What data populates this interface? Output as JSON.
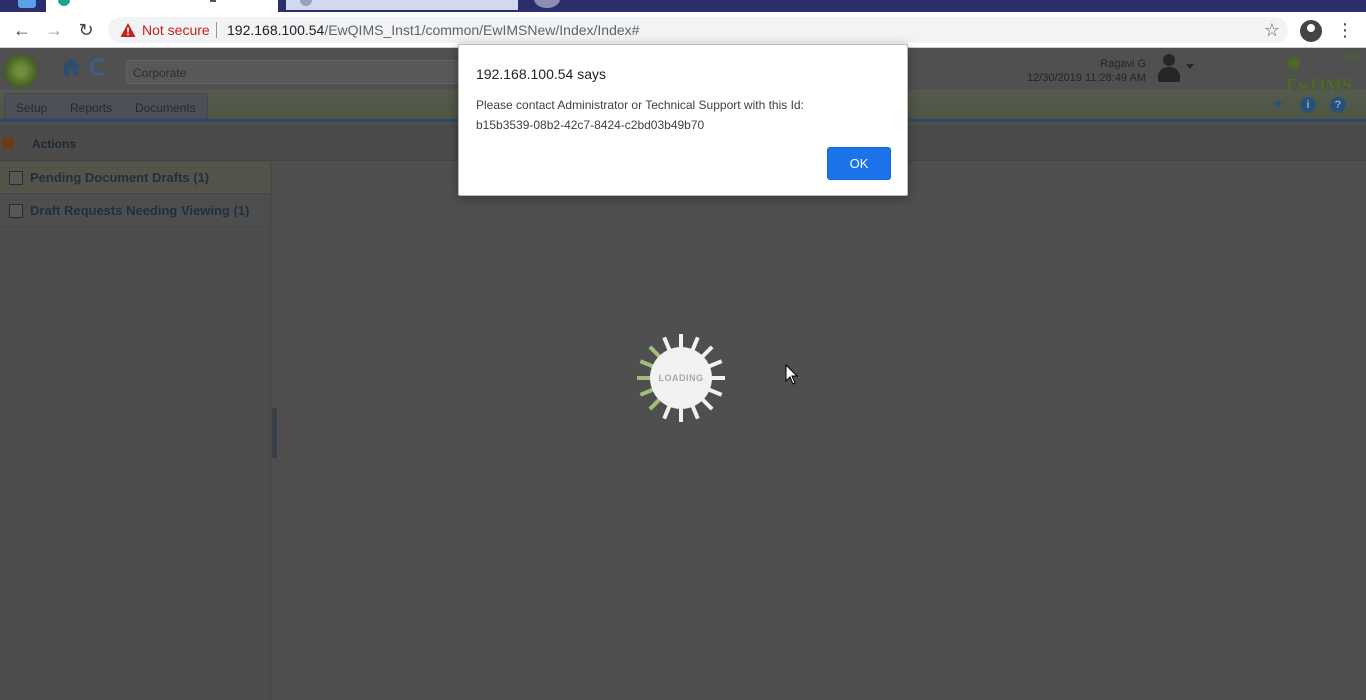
{
  "browser": {
    "security_label": "Not secure",
    "url_host": "192.168.100.54",
    "url_path": "/EwQIMS_Inst1/common/EwIMSNew/Index/Index#"
  },
  "app": {
    "company_field": "Corporate",
    "user": {
      "name": "Ragavi G",
      "datetime": "12/30/2019 11:28:49 AM"
    },
    "brand": {
      "name": "EwQMS",
      "sup": "IMS"
    },
    "menu": [
      "Setup",
      "Reports",
      "Documents"
    ],
    "toolbar_icons": [
      "pin-icon",
      "info-icon",
      "help-icon"
    ],
    "actions_label": "Actions",
    "sidebar": [
      {
        "label": "Pending Document Drafts (1)"
      },
      {
        "label": "Draft Requests Needing Viewing (1)"
      }
    ],
    "loading_text": "LOADING"
  },
  "dialog": {
    "title": "192.168.100.54 says",
    "message": " Please contact Administrator or Technical Support with this Id:\nb15b3539-08b2-42c7-8424-c2bd03b49b70",
    "ok_label": "OK"
  },
  "colors": {
    "accent": "#1a73e8",
    "overlay": "#4f4f4f",
    "security_warning": "#c5221f"
  }
}
